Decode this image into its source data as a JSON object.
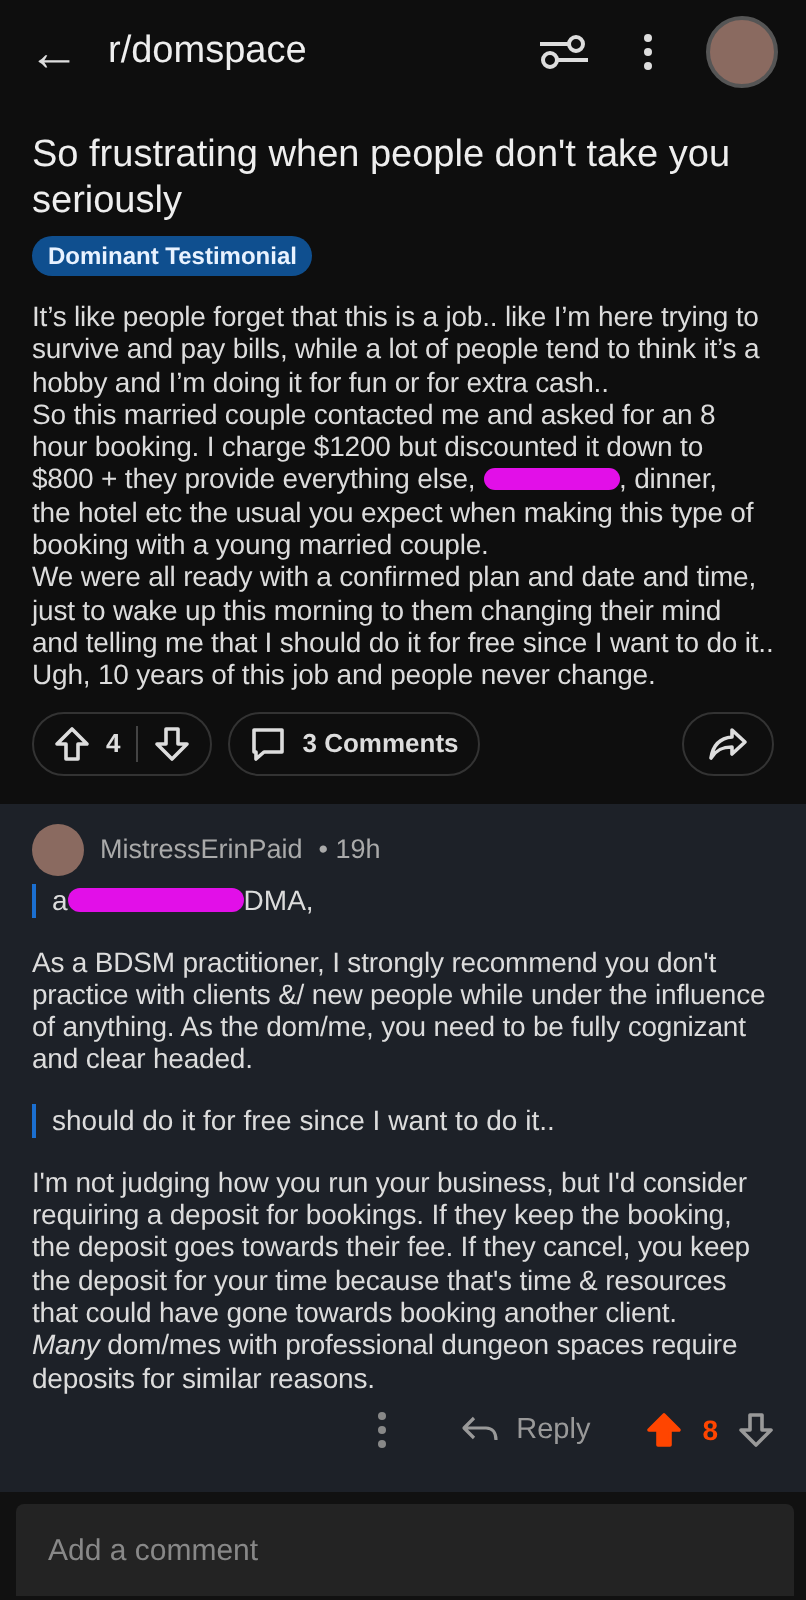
{
  "header": {
    "back": "←",
    "subreddit": "r/domspace"
  },
  "post": {
    "title": "So frustrating when people don't take you seriously",
    "flair": "Dominant Testimonial",
    "paragraphs": [
      {
        "text": "It’s like people forget that this is a job.. like I’m here trying to survive and pay bills, while a lot of people tend to think it’s a hobby and I’m doing it for fun or for extra cash.."
      },
      {
        "text": "So this married couple contacted me and asked for an 8 hour booking. I charge $1200 but discounted it down to"
      },
      {
        "text": "$800 + they provide everything else,",
        "redacted": true,
        "after": ", dinner,"
      },
      {
        "text": "the hotel etc the usual you expect when making this type of booking with a young married couple."
      },
      {
        "text": "We were all ready with a confirmed plan and date and time, just to wake up this morning to them changing their mind and telling me that I should do it for free since I want to do it.."
      },
      {
        "text": "Ugh, 10 years of this job and people never change."
      }
    ],
    "votes": "4",
    "upvoted": false,
    "comments": "3 Comments"
  },
  "comment": {
    "author": "MistressErinPaid",
    "age": "• 19h",
    "blocks": [
      {
        "kind": "quote",
        "text": "a",
        "redacted": true,
        "after": "DMA,"
      },
      {
        "kind": "text",
        "text": "As a BDSM practitioner, I strongly recommend you don't practice with clients &/ new people while under the influence of anything. As the dom/me, you need to be fully cognizant and clear headed."
      },
      {
        "kind": "quote",
        "text": "should do it for free since I want to do it.."
      },
      {
        "kind": "text",
        "text": "I'm not judging how you run your business, but I'd consider requiring a deposit for bookings. If they keep the booking, the deposit goes towards their fee. If they cancel, you keep the deposit for your time because that's time & resources that could have gone towards booking another client."
      },
      {
        "kind": "text",
        "text": "*Many* dom/mes with professional dungeon spaces require deposits for similar reasons."
      }
    ],
    "reply": "Reply",
    "score": "8",
    "upvoted": true
  },
  "composer": {
    "placeholder": "Add a comment"
  }
}
